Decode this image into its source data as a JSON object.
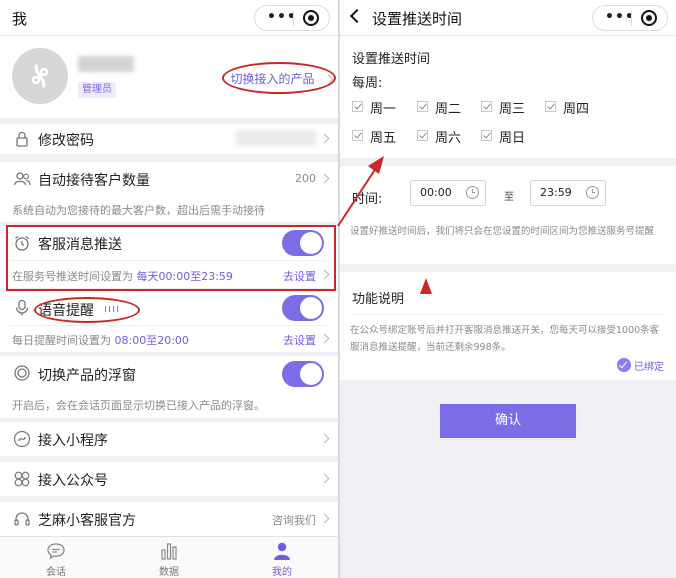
{
  "left": {
    "nav_title": "我",
    "profile": {
      "role_badge": "管理员",
      "switch_link": "切换接入的产品"
    },
    "rows": {
      "change_password": {
        "label": "修改密码"
      },
      "auto_reception": {
        "label": "自动接待客户数量",
        "value": "200",
        "desc": "系统自动为您接待的最大客户数，超出后需手动接待"
      },
      "push": {
        "label": "客服消息推送",
        "desc_prefix": "在服务号推送时间设置为 ",
        "desc_highlight": "每天00:00至23:59",
        "link": "去设置"
      },
      "voice": {
        "label": "语音提醒",
        "desc_prefix": "每日提醒时间设置为 ",
        "desc_highlight": "08:00至20:00",
        "link": "去设置"
      },
      "float": {
        "label": "切换产品的浮窗",
        "desc": "开启后，会在会话页面显示切换已接入产品的浮窗。"
      },
      "mini_program": {
        "label": "接入小程序"
      },
      "official_account": {
        "label": "接入公众号"
      },
      "official": {
        "label": "芝麻小客服官方",
        "value": "咨询我们"
      }
    },
    "tabs": [
      {
        "label": "会话",
        "icon": "chat-icon"
      },
      {
        "label": "数据",
        "icon": "bar-chart-icon"
      },
      {
        "label": "我的",
        "icon": "person-icon"
      }
    ]
  },
  "right": {
    "nav_title": "设置推送时间",
    "section_title": "设置推送时间",
    "weekly_label": "每周:",
    "days": [
      "周一",
      "周二",
      "周三",
      "周四",
      "周五",
      "周六",
      "周日"
    ],
    "time_label": "时间:",
    "start_time": "00:00",
    "to_label": "至",
    "end_time": "23:59",
    "time_note": "设置好推送时间后，我们将只会在您设置的时间区间为您推送服务号提醒",
    "feature_title": "功能说明",
    "feature_text": "在公众号绑定账号后并打开客服消息推送开关，您每天可以接受1000条客服消息推送提醒，当前还剩余998条。",
    "bound_label": "已绑定",
    "confirm_label": "确认"
  },
  "colors": {
    "accent": "#7b6de6",
    "highlight_red": "#c82828",
    "background": "#efeff4"
  }
}
